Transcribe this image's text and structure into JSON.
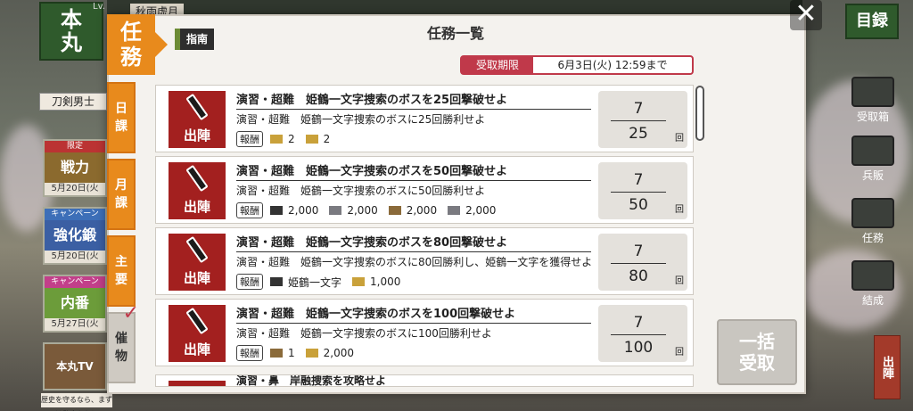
{
  "background": {
    "honmaru_label": [
      "本",
      "丸"
    ],
    "level_label": "Lv.",
    "player_name": "秋雨虚月",
    "toutan_label": "刀剣男士",
    "banners": [
      {
        "tag": "限定",
        "main": "戦力",
        "date": "5月20日(火"
      },
      {
        "tag": "キャンペーン",
        "main": "強化鍛",
        "date": "5月20日(火"
      },
      {
        "tag": "キャンペーン",
        "main": "内番",
        "date": "5月27日(火"
      },
      {
        "tag": "",
        "main": "本丸TV",
        "date": ""
      }
    ],
    "bottom_message": "歴史を守るなら、まずは健康から！",
    "right_menu": {
      "mokuroku": "目録",
      "items": [
        "受取箱",
        "兵販",
        "任務",
        "結成"
      ],
      "shutsujin": "出陣"
    }
  },
  "dialog": {
    "category_tag": [
      "任",
      "務"
    ],
    "guide_label": "指南",
    "title": "任務一覧",
    "deadline_label": "受取期限",
    "deadline_value": "6月3日(火) 12:59まで",
    "close_label": "✕",
    "tabs": [
      {
        "label": [
          "日",
          "課"
        ],
        "active": false
      },
      {
        "label": [
          "月",
          "課"
        ],
        "active": false
      },
      {
        "label": [
          "主",
          "要"
        ],
        "active": false
      },
      {
        "label": [
          "催",
          "物"
        ],
        "active": true
      }
    ],
    "bulk_receive_label": [
      "一括",
      "受取"
    ],
    "icon_label": "出陣",
    "reward_label": "報酬",
    "count_unit": "回",
    "quests": [
      {
        "title": "演習・超難　姫鶴一文字捜索のボスを25回撃破せよ",
        "description": "演習・超難　姫鶴一文字捜索のボスに25回勝利せよ",
        "rewards": [
          {
            "icon": "koban-icon",
            "value": "2"
          },
          {
            "icon": "koban-icon",
            "value": "2"
          }
        ],
        "current": "7",
        "target": "25"
      },
      {
        "title": "演習・超難　姫鶴一文字捜索のボスを50回撃破せよ",
        "description": "演習・超難　姫鶴一文字捜索のボスに50回勝利せよ",
        "rewards": [
          {
            "icon": "charcoal-icon",
            "value": "2,000"
          },
          {
            "icon": "tamahagane-icon",
            "value": "2,000"
          },
          {
            "icon": "cooling-material-icon",
            "value": "2,000"
          },
          {
            "icon": "whetstone-icon",
            "value": "2,000"
          }
        ],
        "current": "7",
        "target": "50"
      },
      {
        "title": "演習・超難　姫鶴一文字捜索のボスを80回撃破せよ",
        "description": "演習・超難　姫鶴一文字捜索のボスに80回勝利し、姫鶴一文字を獲得せよ",
        "rewards": [
          {
            "icon": "sword-icon",
            "value": "姫鶴一文字"
          },
          {
            "icon": "koban-icon",
            "value": "1,000"
          }
        ],
        "current": "7",
        "target": "80"
      },
      {
        "title": "演習・超難　姫鶴一文字捜索のボスを100回撃破せよ",
        "description": "演習・超難　姫鶴一文字捜索のボスに100回勝利せよ",
        "rewards": [
          {
            "icon": "item-box-icon",
            "value": "1"
          },
          {
            "icon": "koban-icon",
            "value": "2,000"
          }
        ],
        "current": "7",
        "target": "100"
      }
    ],
    "partial_quest_title": "演習・鼻　岸融捜索を攻略せよ"
  }
}
